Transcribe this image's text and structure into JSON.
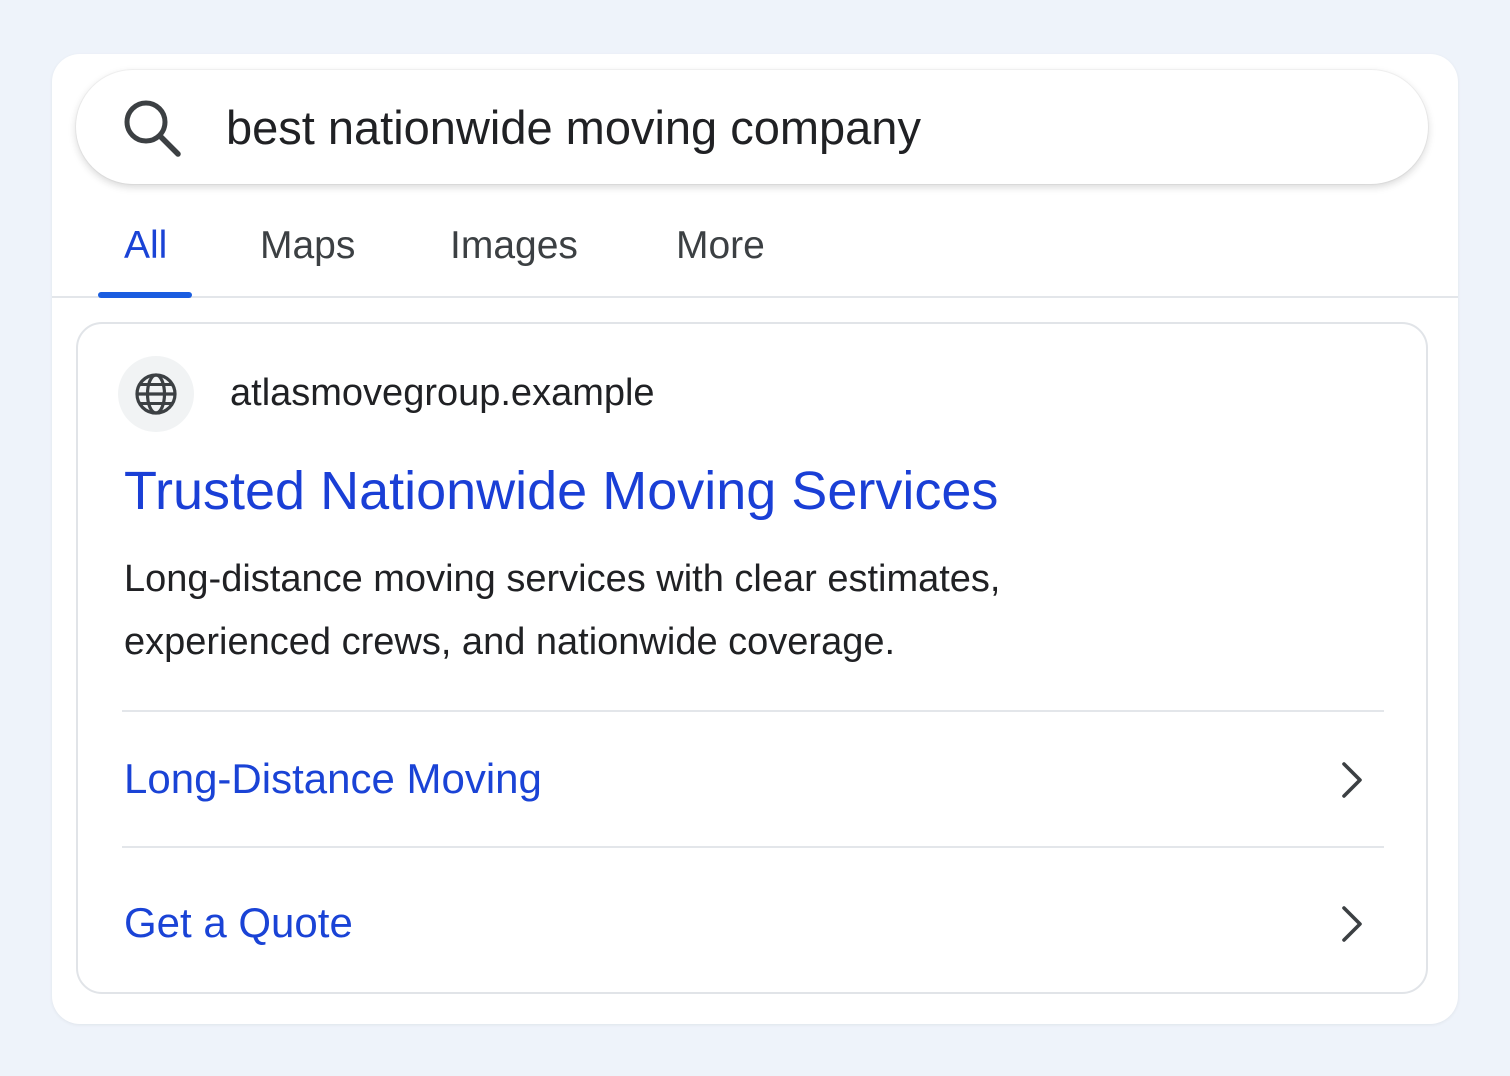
{
  "search": {
    "query": "best nationwide moving company"
  },
  "tabs": [
    {
      "label": "All",
      "active": true
    },
    {
      "label": "Maps",
      "active": false
    },
    {
      "label": "Images",
      "active": false
    },
    {
      "label": "More",
      "active": false
    }
  ],
  "result": {
    "favicon_icon": "globe-icon",
    "site": "atlasmovegroup.example",
    "title": "Trusted Nationwide Moving Services",
    "snippet_line1": "Long-distance moving services with clear estimates,",
    "snippet_line2": "experienced crews, and nationwide coverage.",
    "sitelinks": [
      {
        "label": "Long-Distance Moving",
        "icon": "chevron-right-icon"
      },
      {
        "label": "Get a Quote",
        "icon": "chevron-right-icon"
      }
    ]
  },
  "colors": {
    "link_blue": "#1a3fd6",
    "active_tab_indicator": "#1a5de0",
    "page_background": "#eef3fa"
  }
}
